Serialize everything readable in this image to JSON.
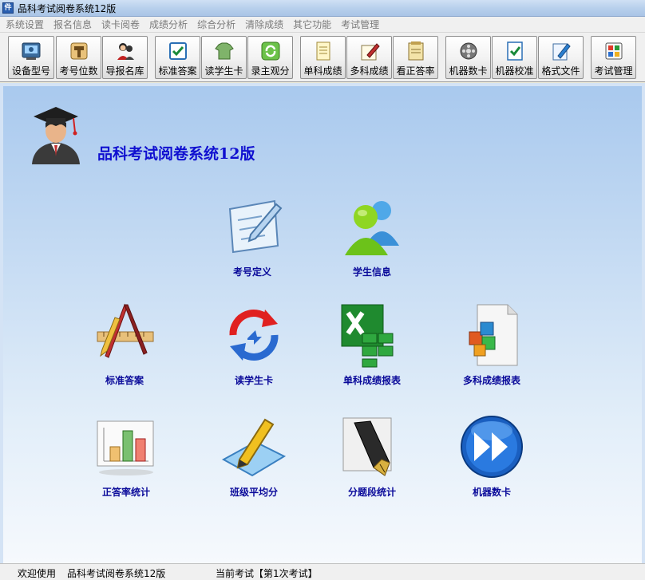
{
  "window": {
    "title": "品科考试阅卷系统12版",
    "icon_label": "件"
  },
  "menu": [
    "系统设置",
    "报名信息",
    "读卡阅卷",
    "成绩分析",
    "综合分析",
    "清除成绩",
    "其它功能",
    "考试管理"
  ],
  "toolbar": [
    {
      "label": "设备型号",
      "icon": "device-icon"
    },
    {
      "label": "考号位数",
      "icon": "hammer-icon"
    },
    {
      "label": "导报名库",
      "icon": "users-icon"
    },
    {
      "label": "标准答案",
      "icon": "checkbox-icon"
    },
    {
      "label": "读学生卡",
      "icon": "shirt-icon"
    },
    {
      "label": "录主观分",
      "icon": "recycle-icon"
    },
    {
      "label": "单科成绩",
      "icon": "document-icon"
    },
    {
      "label": "多科成绩",
      "icon": "pen-paper-icon"
    },
    {
      "label": "看正答率",
      "icon": "notes-icon"
    },
    {
      "label": "机器数卡",
      "icon": "film-reel-icon"
    },
    {
      "label": "机器校准",
      "icon": "check-doc-icon"
    },
    {
      "label": "格式文件",
      "icon": "edit-doc-icon"
    },
    {
      "label": "考试管理",
      "icon": "grid-icon"
    }
  ],
  "main": {
    "system_title": "品科考试阅卷系统12版",
    "features": [
      {
        "label": "考号定义",
        "icon": "notepad-pen-icon"
      },
      {
        "label": "学生信息",
        "icon": "users-group-icon"
      },
      {
        "label": "标准答案",
        "icon": "ruler-pencil-icon"
      },
      {
        "label": "读学生卡",
        "icon": "sync-arrows-icon"
      },
      {
        "label": "单科成绩报表",
        "icon": "excel-icon"
      },
      {
        "label": "多科成绩报表",
        "icon": "cubes-document-icon"
      },
      {
        "label": "正答率统计",
        "icon": "bar-chart-icon"
      },
      {
        "label": "班级平均分",
        "icon": "pencil-pad-icon"
      },
      {
        "label": "分题段统计",
        "icon": "fountain-pen-icon"
      },
      {
        "label": "机器数卡",
        "icon": "fast-forward-icon"
      }
    ]
  },
  "status": {
    "welcome": "欢迎使用",
    "app_name": "品科考试阅卷系统12版",
    "current_exam": "当前考试【第1次考试】"
  }
}
